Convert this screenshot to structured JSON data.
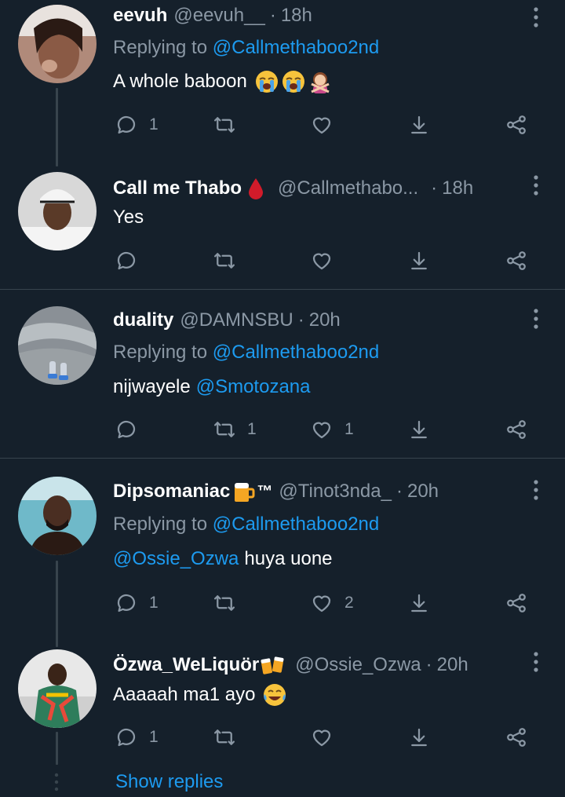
{
  "tweets": [
    {
      "name": "eevuh",
      "handle": "@eevuh__",
      "time": "18h",
      "replying_prefix": "Replying to",
      "replying_to": "@Callmethaboo2nd",
      "text": "A whole baboon",
      "emojis": [
        "loudly-crying-face",
        "loudly-crying-face",
        "person-gesturing-no"
      ],
      "counts": {
        "reply": "1",
        "retweet": "",
        "like": ""
      }
    },
    {
      "name": "Call me Thabo",
      "name_emoji": "drop-of-blood",
      "handle": "@Callmethabo...",
      "time": "18h",
      "text": "Yes",
      "counts": {
        "reply": "",
        "retweet": "",
        "like": ""
      }
    },
    {
      "name": "duality",
      "handle": "@DAMNSBU",
      "time": "20h",
      "replying_prefix": "Replying to",
      "replying_to": "@Callmethaboo2nd",
      "text": "nijwayele",
      "text_mention": "@Smotozana",
      "counts": {
        "reply": "",
        "retweet": "1",
        "like": "1"
      }
    },
    {
      "name": "Dipsomaniac",
      "name_suffix": "™",
      "name_emoji": "beer-mug",
      "handle": "@Tinot3nda_",
      "time": "20h",
      "replying_prefix": "Replying to",
      "replying_to": "@Callmethaboo2nd",
      "text_mention": "@Ossie_Ozwa",
      "text": "huya uone",
      "counts": {
        "reply": "1",
        "retweet": "",
        "like": "2"
      }
    },
    {
      "name": "Özwa_WeLiquör",
      "name_emoji": "clinking-beer-mugs",
      "handle": "@Ossie_Ozwa",
      "time": "20h",
      "text": "Aaaaah ma1 ayo",
      "emojis": [
        "face-with-tears-of-joy"
      ],
      "counts": {
        "reply": "1",
        "retweet": "",
        "like": ""
      }
    }
  ],
  "show_replies": "Show replies",
  "icons": [
    "reply-icon",
    "retweet-icon",
    "like-icon",
    "share-icon",
    "more-icon"
  ],
  "colors": {
    "background": "#15202b",
    "accent": "#1d9bf0",
    "muted": "#8b98a5",
    "divider": "#38444d"
  }
}
